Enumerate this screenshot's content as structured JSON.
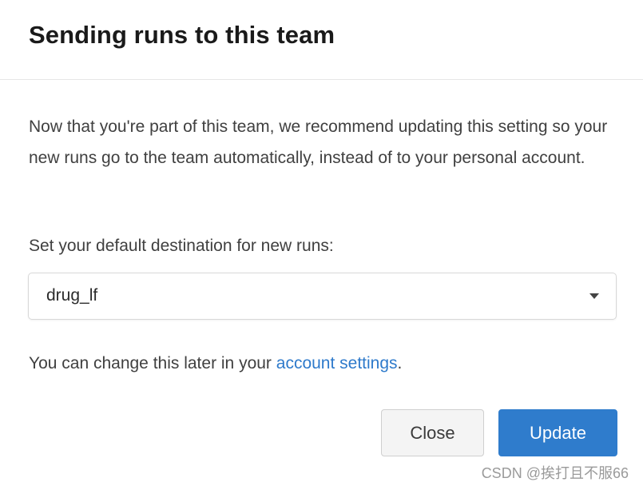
{
  "dialog": {
    "title": "Sending runs to this team",
    "intro": "Now that you're part of this team, we recommend updating this setting so your new runs go to the team automatically, instead of to your personal account.",
    "destination_label": "Set your default destination for new runs:",
    "destination_selected": "drug_lf",
    "note_prefix": "You can change this later in your ",
    "note_link": "account settings",
    "note_suffix": ".",
    "close_label": "Close",
    "update_label": "Update"
  },
  "watermark": "CSDN @挨打且不服66",
  "colors": {
    "accent": "#2f7ccc",
    "link": "#2e7acb",
    "text": "#404040",
    "title": "#1a1a1a"
  }
}
